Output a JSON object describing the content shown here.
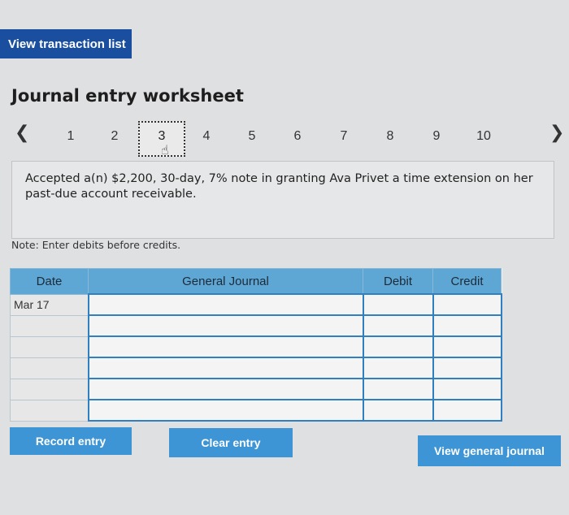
{
  "top_button": {
    "label": "View transaction list"
  },
  "worksheet": {
    "title": "Journal entry worksheet"
  },
  "pager": {
    "prev_icon": "chevron-left-icon",
    "next_icon": "chevron-right-icon",
    "pages": [
      "1",
      "2",
      "3",
      "4",
      "5",
      "6",
      "7",
      "8",
      "9",
      "10"
    ],
    "active_index": 2
  },
  "prompt": {
    "text": "Accepted a(n) $2,200, 30-day, 7% note in granting Ava Privet a time extension on her past-due account receivable."
  },
  "note": {
    "text": "Note: Enter debits before credits."
  },
  "journal": {
    "headers": {
      "date": "Date",
      "general_journal": "General Journal",
      "debit": "Debit",
      "credit": "Credit"
    },
    "rows": [
      {
        "date": "Mar 17",
        "account": "",
        "debit": "",
        "credit": ""
      },
      {
        "date": "",
        "account": "",
        "debit": "",
        "credit": ""
      },
      {
        "date": "",
        "account": "",
        "debit": "",
        "credit": ""
      },
      {
        "date": "",
        "account": "",
        "debit": "",
        "credit": ""
      },
      {
        "date": "",
        "account": "",
        "debit": "",
        "credit": ""
      },
      {
        "date": "",
        "account": "",
        "debit": "",
        "credit": ""
      }
    ]
  },
  "buttons": {
    "record": "Record entry",
    "clear": "Clear entry",
    "view_journal": "View general journal"
  },
  "colors": {
    "primary_blue": "#1a4fa0",
    "button_blue": "#3d95d6",
    "header_blue": "#5ea6d4"
  }
}
